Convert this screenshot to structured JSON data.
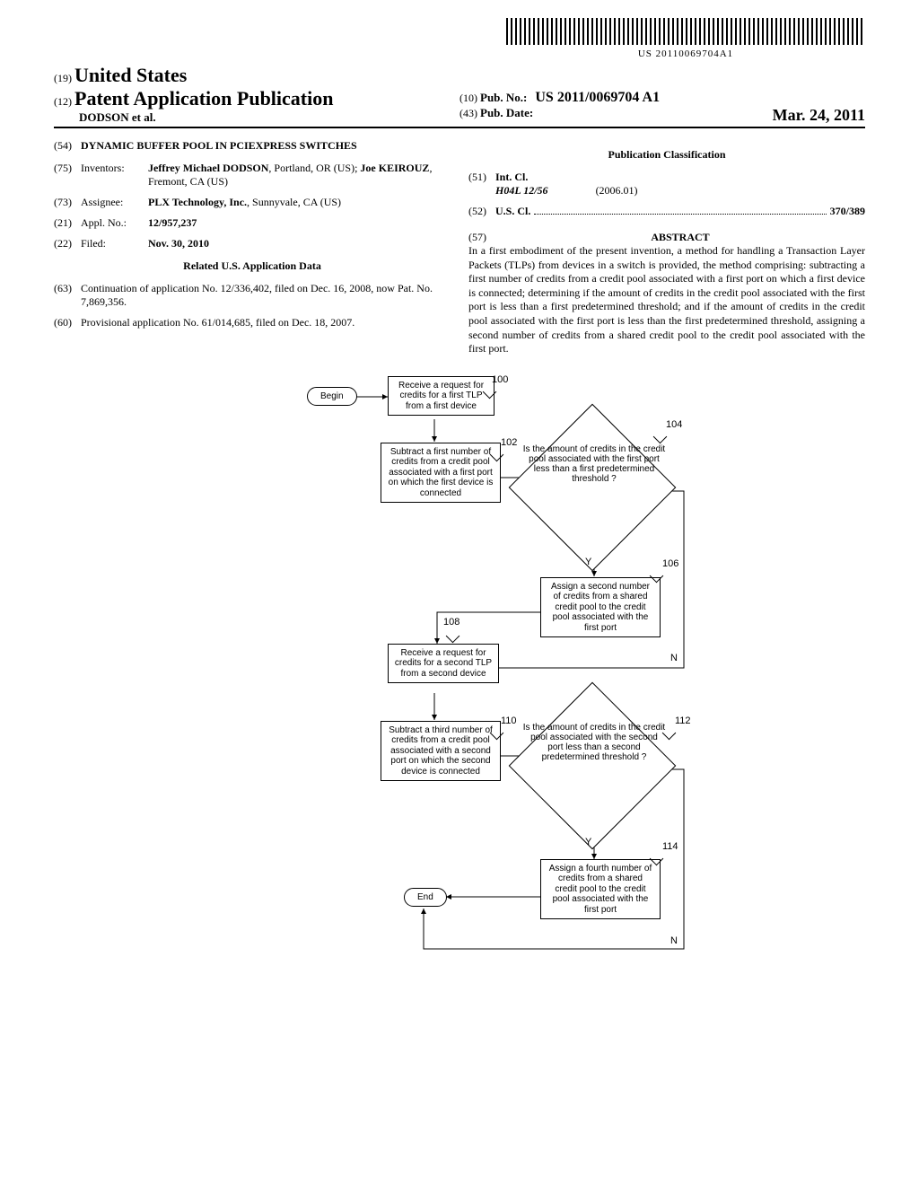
{
  "barcode_text": "US 20110069704A1",
  "header": {
    "code19": "(19)",
    "country": "United States",
    "code12": "(12)",
    "pub_type": "Patent Application Publication",
    "authors": "DODSON et al.",
    "code10": "(10)",
    "pub_no_label": "Pub. No.:",
    "pub_no": "US 2011/0069704 A1",
    "code43": "(43)",
    "pub_date_label": "Pub. Date:",
    "pub_date": "Mar. 24, 2011"
  },
  "left": {
    "c54": "(54)",
    "title": "DYNAMIC BUFFER POOL IN PCIEXPRESS SWITCHES",
    "c75": "(75)",
    "inventors_label": "Inventors:",
    "inventors": "Jeffrey Michael DODSON, Portland, OR (US); Joe KEIROUZ, Fremont, CA (US)",
    "c73": "(73)",
    "assignee_label": "Assignee:",
    "assignee": "PLX Technology, Inc., Sunnyvale, CA (US)",
    "c21": "(21)",
    "appl_no_label": "Appl. No.:",
    "appl_no": "12/957,237",
    "c22": "(22)",
    "filed_label": "Filed:",
    "filed": "Nov. 30, 2010",
    "related_header": "Related U.S. Application Data",
    "c63": "(63)",
    "continuation": "Continuation of application No. 12/336,402, filed on Dec. 16, 2008, now Pat. No. 7,869,356.",
    "c60": "(60)",
    "provisional": "Provisional application No. 61/014,685, filed on Dec. 18, 2007."
  },
  "right": {
    "class_header": "Publication Classification",
    "c51": "(51)",
    "intcl_label": "Int. Cl.",
    "intcl_code": "H04L 12/56",
    "intcl_date": "(2006.01)",
    "c52": "(52)",
    "uscl_label": "U.S. Cl.",
    "uscl_value": "370/389",
    "c57": "(57)",
    "abstract_label": "ABSTRACT",
    "abstract": "In a first embodiment of the present invention, a method for handling a Transaction Layer Packets (TLPs) from devices in a switch is provided, the method comprising: subtracting a first number of credits from a credit pool associated with a first port on which a first device is connected; determining if the amount of credits in the credit pool associated with the first port is less than a first predetermined threshold; and if the amount of credits in the credit pool associated with the first port is less than the first predetermined threshold, assigning a second number of credits from a shared credit pool to the credit pool associated with the first port."
  },
  "flow": {
    "begin": "Begin",
    "end": "End",
    "b100": "Receive a request for credits for a first TLP from a first device",
    "r100": "100",
    "b102": "Subtract a first number of credits from a credit pool associated with a first port on which the first device is connected",
    "r102": "102",
    "d104": "Is the amount of credits in the credit pool associated with the first port less than a first predetermined threshold ?",
    "r104": "104",
    "b106": "Assign a second number of credits from a shared credit pool to the credit pool associated with the first port",
    "r106": "106",
    "b108": "Receive a request for credits for a second TLP from a second device",
    "r108": "108",
    "b110": "Subtract a third number of credits from a credit pool associated with a second port on which the second device is connected",
    "r110": "110",
    "d112": "Is the amount of credits in the credit pool associated with the second port less than a second predetermined threshold ?",
    "r112": "112",
    "b114": "Assign a fourth number of credits from a shared credit pool to the credit pool associated with the first port",
    "r114": "114",
    "Y": "Y",
    "N": "N"
  }
}
